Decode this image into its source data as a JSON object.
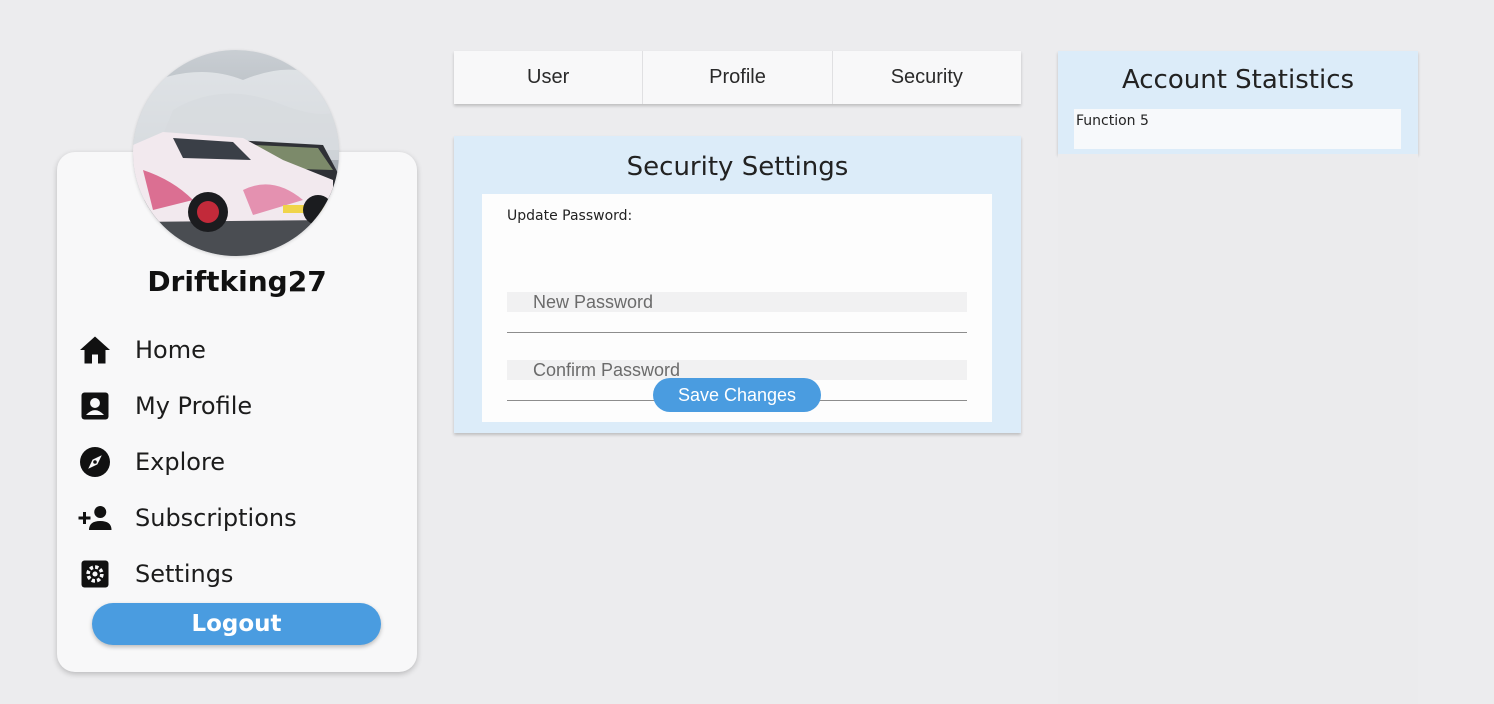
{
  "user": {
    "username": "Driftking27",
    "avatar_icon": "drift-car-photo"
  },
  "sidebar": {
    "items": [
      {
        "label": "Home",
        "icon": "home-icon"
      },
      {
        "label": "My Profile",
        "icon": "profile-card-icon"
      },
      {
        "label": "Explore",
        "icon": "compass-icon"
      },
      {
        "label": "Subscriptions",
        "icon": "add-person-icon"
      },
      {
        "label": "Settings",
        "icon": "gear-icon"
      }
    ],
    "logout_label": "Logout"
  },
  "tabs": [
    {
      "label": "User"
    },
    {
      "label": "Profile"
    },
    {
      "label": "Security"
    }
  ],
  "security": {
    "title": "Security Settings",
    "update_label": "Update Password:",
    "new_password": {
      "placeholder": "New Password",
      "value": ""
    },
    "confirm_password": {
      "placeholder": "Confirm Password",
      "value": ""
    },
    "save_label": "Save Changes"
  },
  "stats": {
    "title": "Account Statistics",
    "items": [
      {
        "label": "Function 5"
      }
    ]
  },
  "colors": {
    "accent": "#4a9ce0",
    "panel_blue": "#dcecf9",
    "background": "#ececee"
  }
}
